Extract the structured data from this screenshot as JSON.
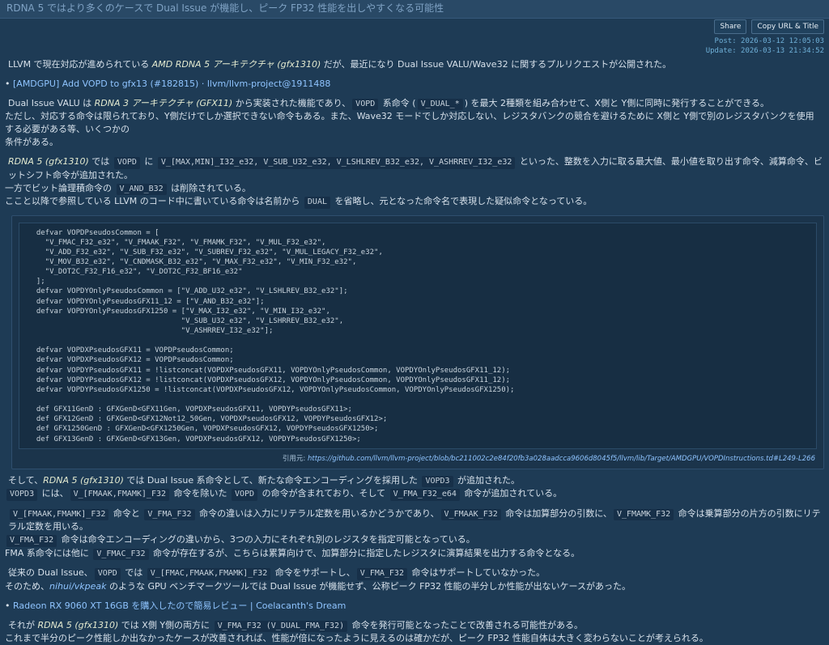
{
  "header": {
    "title": "RDNA 5 ではより多くのケースで Dual Issue が機能し、ピーク FP32 性能を出しやすくなる可能性"
  },
  "actions": {
    "share_label": "Share",
    "copy_label": "Copy URL & Title"
  },
  "meta": {
    "post": "Post: 2026-03-12 12:05:03",
    "update": "Update: 2026-03-13 21:34:52"
  },
  "intro": {
    "a": "LLVM で現在対応が進められている ",
    "b": "AMD RDNA 5 アーキテクチャ (gfx1310)",
    "c": " だが、最近になり Dual Issue VALU/Wave32 に関するプルリクエストが公開された。"
  },
  "link1": "[AMDGPU] Add VOPD to gfx13 (#182815) · llvm/llvm-project@1911488",
  "para1": {
    "a": "Dual Issue VALU は ",
    "b": "RDNA 3 アーキテクチャ (GFX11)",
    "c": " から実装された機能であり、",
    "code1": "VOPD",
    "d": " 系命令 (",
    "code2": "V_DUAL_*",
    "e": ") を最大 2種類を組み合わせて、X側と Y側に同時に発行することができる。",
    "line2": "ただし、対応する命令は限られており、Y側だけでしか選択できない命令もある。また、Wave32 モードでしか対応しない、レジスタバンクの競合を避けるために X側と Y側で別のレジスタバンクを使用する必要がある等、いくつかの",
    "line3": "条件がある。"
  },
  "para2": {
    "a": "RDNA 5 (gfx1310)",
    "b": " では ",
    "code1": "VOPD",
    "c": " に ",
    "code2": "V_[MAX,MIN]_I32_e32, V_SUB_U32_e32, V_LSHLREV_B32_e32, V_ASHRREV_I32_e32",
    "d": " といった、整数を入力に取る最大値、最小値を取り出す命令、減算命令、ビットシフト命令が追加された。",
    "l2a": "一方でビット論理積命令の ",
    "l2code": "V_AND_B32",
    "l2b": " は削除されている。",
    "l3a": "ここと以降で参照している LLVM のコード中に書いている命令は名前から ",
    "l3code": "DUAL",
    "l3b": " を省略し、元となった命令名で表現した疑似命令となっている。"
  },
  "code_block": "  defvar VOPDPseudosCommon = [\n    \"V_FMAC_F32_e32\", \"V_FMAAK_F32\", \"V_FMAMK_F32\", \"V_MUL_F32_e32\",\n    \"V_ADD_F32_e32\", \"V_SUB_F32_e32\", \"V_SUBREV_F32_e32\", \"V_MUL_LEGACY_F32_e32\",\n    \"V_MOV_B32_e32\", \"V_CNDMASK_B32_e32\", \"V_MAX_F32_e32\", \"V_MIN_F32_e32\",\n    \"V_DOT2C_F32_F16_e32\", \"V_DOT2C_F32_BF16_e32\"\n  ];\n  defvar VOPDYOnlyPseudosCommon = [\"V_ADD_U32_e32\", \"V_LSHLREV_B32_e32\"];\n  defvar VOPDYOnlyPseudosGFX11_12 = [\"V_AND_B32_e32\"];\n  defvar VOPDYOnlyPseudosGFX1250 = [\"V_MAX_I32_e32\", \"V_MIN_I32_e32\",\n                                   \"V_SUB_U32_e32\", \"V_LSHRREV_B32_e32\",\n                                   \"V_ASHRREV_I32_e32\"];\n\n  defvar VOPDXPseudosGFX11 = VOPDPseudosCommon;\n  defvar VOPDXPseudosGFX12 = VOPDPseudosCommon;\n  defvar VOPDYPseudosGFX11 = !listconcat(VOPDXPseudosGFX11, VOPDYOnlyPseudosCommon, VOPDYOnlyPseudosGFX11_12);\n  defvar VOPDYPseudosGFX12 = !listconcat(VOPDXPseudosGFX12, VOPDYOnlyPseudosCommon, VOPDYOnlyPseudosGFX11_12);\n  defvar VOPDYPseudosGFX1250 = !listconcat(VOPDXPseudosGFX12, VOPDYOnlyPseudosCommon, VOPDYOnlyPseudosGFX1250);\n\n  def GFX11GenD : GFXGenD<GFX11Gen, VOPDXPseudosGFX11, VOPDYPseudosGFX11>;\n  def GFX12GenD : GFXGenD<GFX12Not12_50Gen, VOPDXPseudosGFX12, VOPDYPseudosGFX12>;\n  def GFX1250GenD : GFXGenD<GFX1250Gen, VOPDXPseudosGFX12, VOPDYPseudosGFX1250>;\n  def GFX13GenD : GFXGenD<GFX13Gen, VOPDXPseudosGFX12, VOPDYPseudosGFX1250>;",
  "caption": {
    "label": "引用元: ",
    "url": "https://github.com/llvm/llvm-project/blob/bc211002c2e84f20fb3a028aadcca9606d8045f5/llvm/lib/Target/AMDGPU/VOPDInstructions.td#L249-L266"
  },
  "para3": {
    "a": "そして、",
    "b": "RDNA 5 (gfx1310)",
    "c": " では Dual Issue 系命令として、新たな命令エンコーディングを採用した ",
    "code1": "VOPD3",
    "d": " が追加された。",
    "l2code1": "VOPD3",
    "l2a": " には、",
    "l2code2": "V_[FMAAK,FMAMK]_F32",
    "l2b": " 命令を除いた ",
    "l2code3": "VOPD",
    "l2c": " の命令が含まれており、そして ",
    "l2code4": "V_FMA_F32_e64",
    "l2d": " 命令が追加されている。"
  },
  "para4": {
    "code1": "V_[FMAAK,FMAMK]_F32",
    "a": " 命令と ",
    "code2": "V_FMA_F32",
    "b": " 命令の違いは入力にリテラル定数を用いるかどうかであり、",
    "code3": "V_FMAAK_F32",
    "c": " 命令は加算部分の引数に、",
    "code4": "V_FMAMK_F32",
    "d": " 命令は乗算部分の片方の引数にリテラル定数を用いる。",
    "l2code": "V_FMA_F32",
    "l2a": " 命令は命令エンコーディングの違いから、3つの入力にそれぞれ別のレジスタを指定可能となっている。",
    "l3a": "FMA 系命令には他に ",
    "l3code": "V_FMAC_F32",
    "l3b": " 命令が存在するが、こちらは累算向けで、加算部分に指定したレジスタに演算結果を出力する命令となる。"
  },
  "para5": {
    "a": "従来の Dual Issue、",
    "code1": "VOPD",
    "b": " では ",
    "code2": "V_[FMAC,FMAAK,FMAMK]_F32",
    "c": " 命令をサポートし、",
    "code3": "V_FMA_F32",
    "d": " 命令はサポートしていなかった。",
    "l2a": "そのため、",
    "l2link": "nihui/vkpeak",
    "l2b": " のような GPU ベンチマークツールでは Dual Issue が機能せず、公称ピーク FP32 性能の半分しか性能が出ないケースがあった。"
  },
  "link2": "Radeon RX 9060 XT 16GB を購入したので簡易レビュー | Coelacanth's Dream",
  "para6": {
    "a": "それが ",
    "b": "RDNA 5 (gfx1310)",
    "c": " では X側 Y側の両方に ",
    "code1": "V_FMA_F32 (V_DUAL_FMA_F32)",
    "d": " 命令を発行可能となったことで改善される可能性がある。",
    "line2": "これまで半分のピーク性能しか出なかったケースが改善されれば、性能が倍になったように見えるのは確かだが、ピーク FP32 性能自体は大きく変わらないことが考えられる。"
  }
}
